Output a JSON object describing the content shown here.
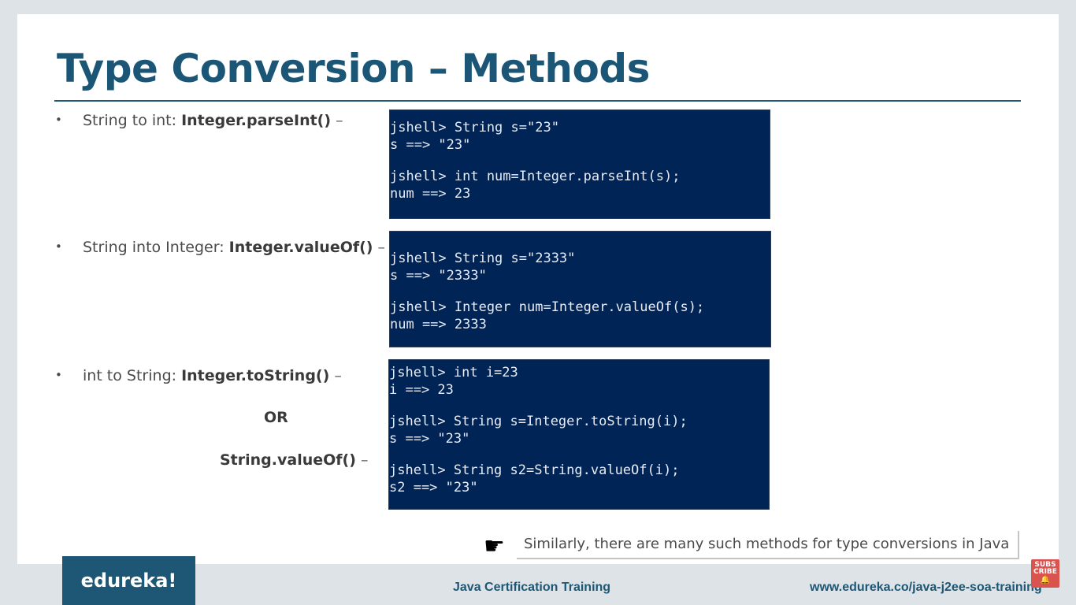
{
  "slide": {
    "title": "Type Conversion – Methods",
    "bullets": [
      {
        "prefix": "String to int: ",
        "method": "Integer.parseInt()",
        "suffix": " –"
      },
      {
        "prefix": "String into Integer: ",
        "method": "Integer.valueOf()",
        "suffix": " –"
      },
      {
        "prefix": "int to String: ",
        "method": "Integer.toString()",
        "suffix": " –"
      }
    ],
    "or_label": "OR",
    "alt_method": "String.valueOf()",
    "alt_suffix": " –",
    "terminals": [
      {
        "lines": [
          "jshell> String s=\"23\"",
          "s ==> \"23\"",
          "",
          "jshell> int num=Integer.parseInt(s);",
          "num ==> 23"
        ]
      },
      {
        "lines": [
          "jshell> String s=\"2333\"",
          "s ==> \"2333\"",
          "",
          "jshell> Integer num=Integer.valueOf(s);",
          "num ==> 2333"
        ]
      },
      {
        "lines": [
          "jshell> int i=23",
          "i ==> 23",
          "",
          "jshell> String s=Integer.toString(i);",
          "s ==> \"23\"",
          "",
          "jshell> String s2=String.valueOf(i);",
          "s2 ==> \"23\""
        ]
      }
    ],
    "note": "Similarly, there are many such methods for type conversions in Java",
    "note_icon": "pointing-hand-icon"
  },
  "footer": {
    "logo": "edureka!",
    "center": "Java Certification Training",
    "url": "www.edureka.co/java-j2ee-soa-training"
  },
  "subscribe": {
    "line1": "SUBS",
    "line2": "CRIBE",
    "icon": "bell-icon"
  },
  "colors": {
    "title": "#1b5676",
    "terminal_bg": "#012456",
    "brand": "#1d5775",
    "subscribe_bg": "#d9534f"
  }
}
